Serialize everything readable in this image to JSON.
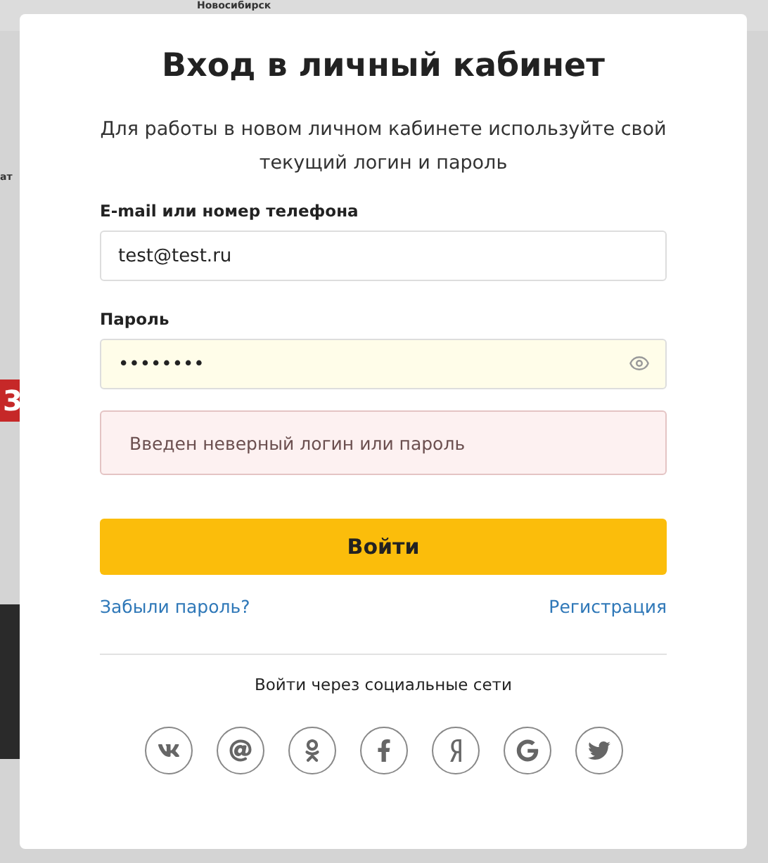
{
  "backdrop": {
    "city": "Новосибирск",
    "side_text": "ат",
    "badge": "3"
  },
  "dialog": {
    "title": "Вход в личный кабинет",
    "subtitle": "Для работы в новом личном кабинете используйте свой текущий логин и пароль",
    "login_field": {
      "label": "E-mail или номер телефона",
      "value": "test@test.ru"
    },
    "password_field": {
      "label": "Пароль",
      "value": "••••••••",
      "autofilled": true
    },
    "error": "Введен неверный логин или пароль",
    "submit": "Войти",
    "forgot_link": "Забыли пароль?",
    "register_link": "Регистрация",
    "social_heading": "Войти через социальные сети",
    "socials": [
      {
        "kind": "b"
      },
      {
        "kind": "at"
      },
      {
        "kind": "ok"
      },
      {
        "kind": "f"
      },
      {
        "kind": "ya"
      },
      {
        "kind": "g"
      },
      {
        "kind": "bird"
      }
    ]
  }
}
